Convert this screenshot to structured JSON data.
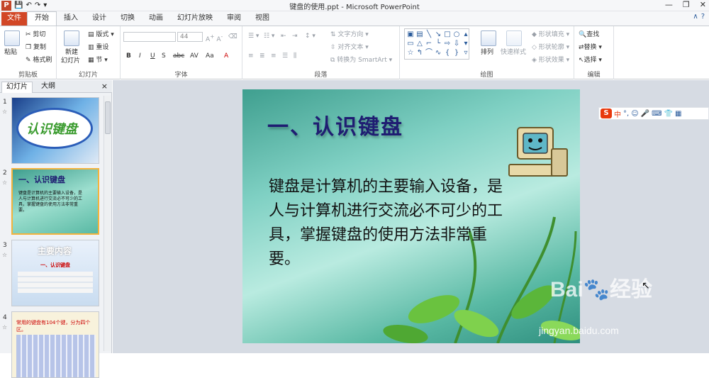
{
  "window": {
    "title": "键盘的使用.ppt - Microsoft PowerPoint",
    "app_logo": "P",
    "controls": [
      "—",
      "❐",
      "✕"
    ]
  },
  "ribbon_tabs": [
    "文件",
    "开始",
    "插入",
    "设计",
    "切换",
    "动画",
    "幻灯片放映",
    "审阅",
    "视图"
  ],
  "ribbon": {
    "clipboard": {
      "label": "剪贴板",
      "paste": "粘贴",
      "cut": "剪切",
      "copy": "复制",
      "format_painter": "格式刷"
    },
    "slides": {
      "label": "幻灯片",
      "new_slide": "新建",
      "new_slide2": "幻灯片",
      "layout": "版式",
      "reset": "重设",
      "section": "节"
    },
    "font": {
      "label": "字体",
      "size": "44",
      "bold": "B",
      "italic": "I",
      "underline": "U",
      "strike": "S",
      "shadow": "abc",
      "spacing": "AV",
      "case": "Aa",
      "color": "A"
    },
    "paragraph": {
      "label": "段落",
      "text_dir": "文字方向",
      "align_text": "对齐文本",
      "smartart": "转换为 SmartArt"
    },
    "drawing": {
      "label": "绘图",
      "arrange": "排列",
      "quick_styles": "快速样式",
      "fill": "形状填充",
      "outline": "形状轮廓",
      "effects": "形状效果"
    },
    "editing": {
      "label": "编辑",
      "find": "查找",
      "replace": "替换",
      "select": "选择"
    }
  },
  "pane": {
    "tab_slides": "幻灯片",
    "tab_outline": "大纲",
    "close": "×"
  },
  "thumbnails": [
    {
      "num": "1",
      "title": "认识键盘"
    },
    {
      "num": "2",
      "title": "一、认识键盘",
      "body": "键盘是计算机的主要输入设备，是人与计算机进行交流必不可少的工具，掌握键盘的使用方法非常重要。"
    },
    {
      "num": "3",
      "title": "主要内容",
      "body": "一、认识键盘"
    },
    {
      "num": "4",
      "title": "常用的键盘有104个键，分为四个区。"
    }
  ],
  "slide": {
    "title": "一、认识键盘",
    "body": "键盘是计算机的主要输入设备，是人与计算机进行交流必不可少的工具，掌握键盘的使用方法非常重要。"
  },
  "ime": {
    "brand": "S",
    "mode": "中"
  },
  "watermark": {
    "brand": "Bai",
    "brand2": "经验",
    "url": "jingyan.baidu.com"
  }
}
